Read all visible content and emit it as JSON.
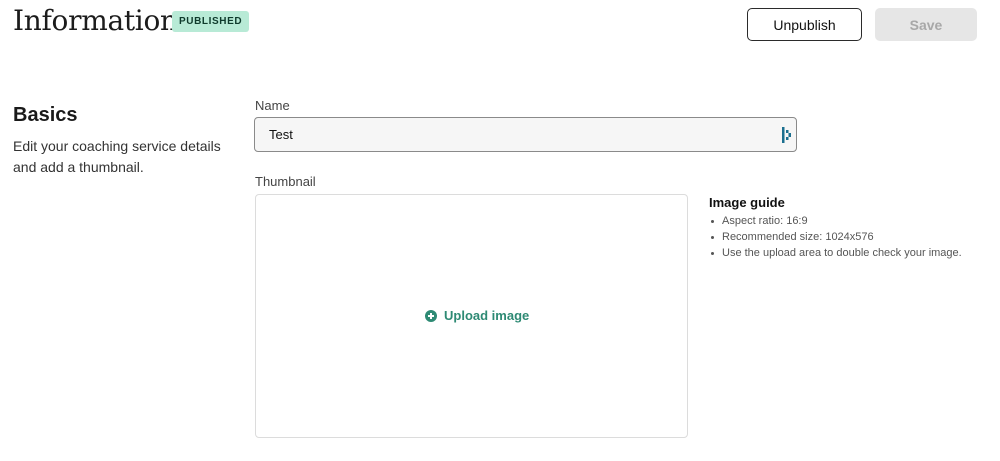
{
  "header": {
    "title": "Information",
    "status_badge": "PUBLISHED",
    "unpublish_label": "Unpublish",
    "save_label": "Save"
  },
  "basics": {
    "heading": "Basics",
    "description": "Edit your coaching service details and add a thumbnail."
  },
  "form": {
    "name_label": "Name",
    "name_value": "Test",
    "thumbnail_label": "Thumbnail",
    "upload_label": "Upload image"
  },
  "image_guide": {
    "title": "Image guide",
    "items": [
      "Aspect ratio: 16:9",
      "Recommended size: 1024x576",
      "Use the upload area to double check your image."
    ]
  },
  "colors": {
    "accent": "#2e8a74",
    "badge_bg": "#b8ead6"
  },
  "icons": {
    "upload": "plus-circle-icon",
    "input_extension": "grammarly-icon"
  }
}
